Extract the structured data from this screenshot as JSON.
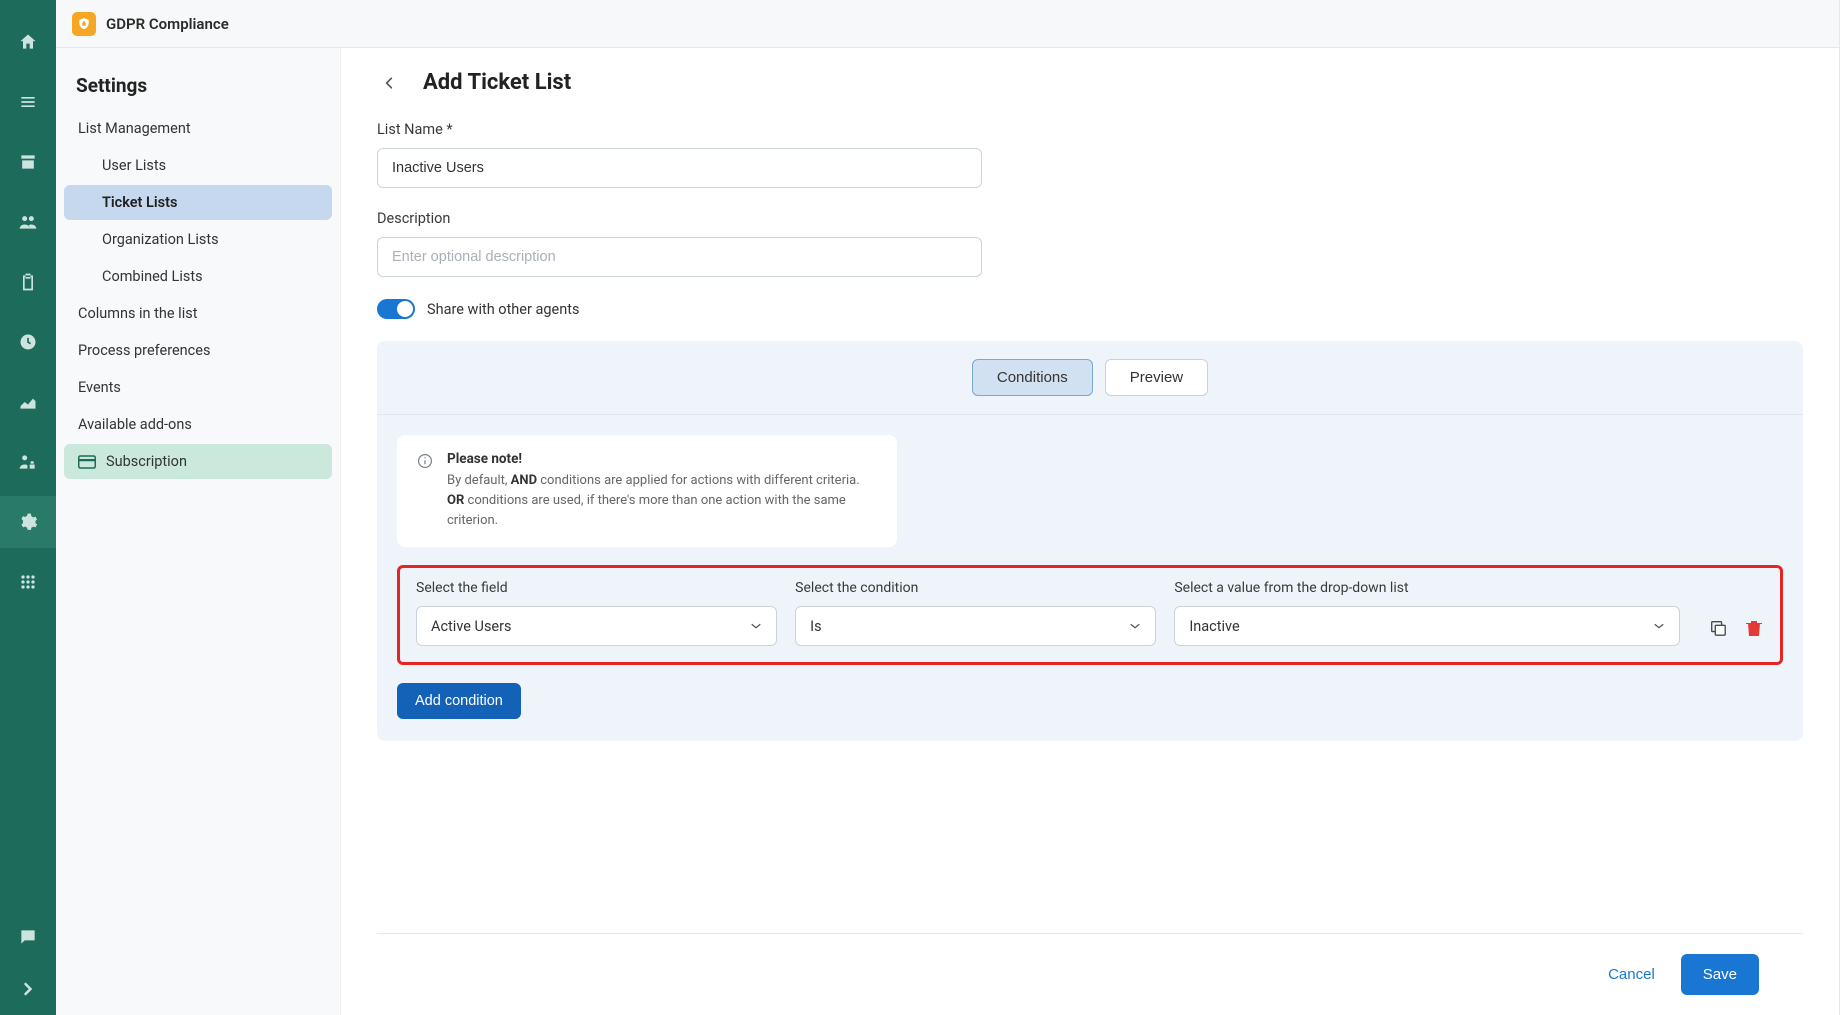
{
  "app": {
    "title": "GDPR Compliance"
  },
  "sidebar": {
    "heading": "Settings",
    "items": [
      {
        "label": "List Management"
      },
      {
        "label": "User Lists"
      },
      {
        "label": "Ticket Lists"
      },
      {
        "label": "Organization Lists"
      },
      {
        "label": "Combined Lists"
      },
      {
        "label": "Columns in the list"
      },
      {
        "label": "Process preferences"
      },
      {
        "label": "Events"
      },
      {
        "label": "Available add-ons"
      },
      {
        "label": "Subscription"
      }
    ]
  },
  "page": {
    "title": "Add Ticket List",
    "list_name_label": "List Name *",
    "list_name_value": "Inactive Users",
    "description_label": "Description",
    "description_placeholder": "Enter optional description",
    "share_label": "Share with other agents",
    "tabs": {
      "conditions": "Conditions",
      "preview": "Preview"
    },
    "note": {
      "title": "Please note!",
      "line1_a": "By default, ",
      "line1_bold": "AND",
      "line1_b": " conditions are applied for actions with different criteria.",
      "line2_bold": "OR",
      "line2_b": " conditions are used, if there's more than one action with the same criterion."
    },
    "condition": {
      "field_label": "Select the field",
      "condition_label": "Select the condition",
      "value_label": "Select a value from the drop-down list",
      "field_value": "Active Users",
      "condition_value": "Is",
      "value_value": "Inactive"
    },
    "add_condition": "Add condition",
    "cancel": "Cancel",
    "save": "Save"
  }
}
